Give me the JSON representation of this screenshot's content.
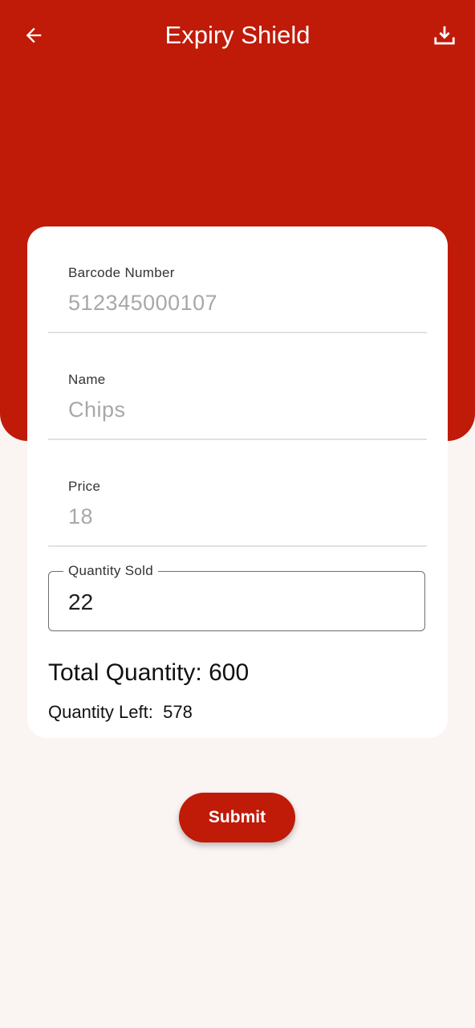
{
  "app_bar": {
    "title": "Expiry Shield",
    "back_icon": "arrow-left-icon",
    "download_icon": "download-icon"
  },
  "form": {
    "barcode": {
      "label": "Barcode Number",
      "value": "512345000107"
    },
    "name": {
      "label": "Name",
      "value": "Chips"
    },
    "price": {
      "label": "Price",
      "value": "18"
    },
    "quantity_sold": {
      "label": "Quantity Sold",
      "value": "22"
    },
    "total_quantity": {
      "label": "Total Quantity: ",
      "value": "600"
    },
    "quantity_left": {
      "label": "Quantity Left: ",
      "value": "578"
    }
  },
  "submit_label": "Submit",
  "colors": {
    "primary": "#c01a08",
    "background": "#faf4f2",
    "card": "#ffffff"
  }
}
